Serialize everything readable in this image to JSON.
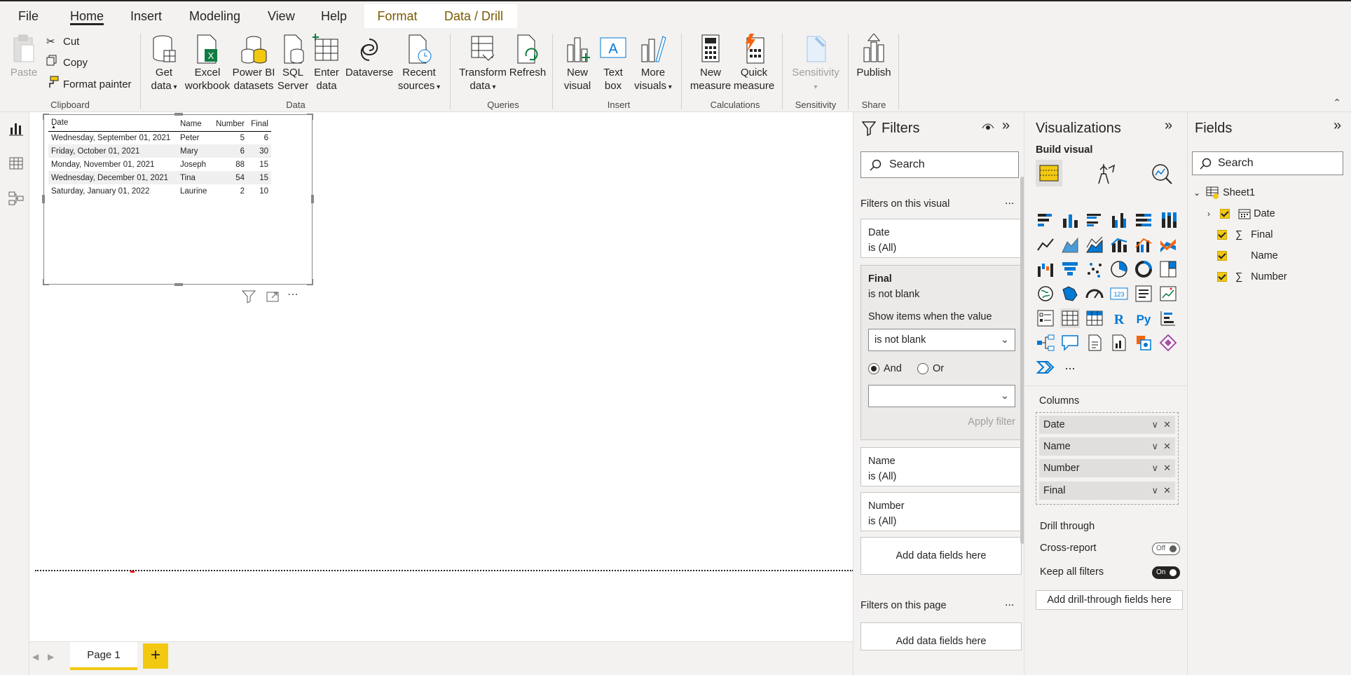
{
  "menu": {
    "tabs": [
      "File",
      "Home",
      "Insert",
      "Modeling",
      "View",
      "Help",
      "Format",
      "Data / Drill"
    ]
  },
  "ribbon": {
    "clipboard": {
      "paste": "Paste",
      "cut": "Cut",
      "copy": "Copy",
      "format_painter": "Format painter",
      "label": "Clipboard"
    },
    "data": {
      "get_data": [
        "Get",
        "data"
      ],
      "excel": [
        "Excel",
        "workbook"
      ],
      "powerbi": [
        "Power BI",
        "datasets"
      ],
      "sql": [
        "SQL",
        "Server"
      ],
      "enter": [
        "Enter",
        "data"
      ],
      "dataverse": "Dataverse",
      "recent": [
        "Recent",
        "sources"
      ],
      "label": "Data"
    },
    "queries": {
      "transform": [
        "Transform",
        "data"
      ],
      "refresh": "Refresh",
      "label": "Queries"
    },
    "insert": {
      "new_visual": [
        "New",
        "visual"
      ],
      "text_box": [
        "Text",
        "box"
      ],
      "more_visuals": [
        "More",
        "visuals"
      ],
      "label": "Insert"
    },
    "calculations": {
      "new_measure": [
        "New",
        "measure"
      ],
      "quick_measure": [
        "Quick",
        "measure"
      ],
      "label": "Calculations"
    },
    "sensitivity": {
      "btn": "Sensitivity",
      "label": "Sensitivity"
    },
    "share": {
      "publish": "Publish",
      "label": "Share"
    }
  },
  "table": {
    "headers": [
      "Date",
      "Name",
      "Number",
      "Final"
    ],
    "rows": [
      [
        "Wednesday, September 01, 2021",
        "Peter",
        "5",
        "6"
      ],
      [
        "Friday, October 01, 2021",
        "Mary",
        "6",
        "30"
      ],
      [
        "Monday, November 01, 2021",
        "Joseph",
        "88",
        "15"
      ],
      [
        "Wednesday, December 01, 2021",
        "Tina",
        "54",
        "15"
      ],
      [
        "Saturday, January 01, 2022",
        "Laurine",
        "2",
        "10"
      ]
    ]
  },
  "pages": {
    "tab": "Page 1",
    "add": "+"
  },
  "filters": {
    "title": "Filters",
    "search_placeholder": "Search",
    "on_visual": "Filters on this visual",
    "more": "...",
    "date_card": {
      "name": "Date",
      "state": "is (All)"
    },
    "final_card": {
      "name": "Final",
      "state": "is not blank",
      "show_items": "Show items when the value",
      "condition": "is not blank",
      "and": "And",
      "or": "Or",
      "apply": "Apply filter"
    },
    "name_card": {
      "name": "Name",
      "state": "is (All)"
    },
    "number_card": {
      "name": "Number",
      "state": "is (All)"
    },
    "add_fields": "Add data fields here",
    "on_page": "Filters on this page",
    "add_fields_page": "Add data fields here"
  },
  "visualizations": {
    "title": "Visualizations",
    "build": "Build visual",
    "more": "...",
    "columns_label": "Columns",
    "columns": [
      "Date",
      "Name",
      "Number",
      "Final"
    ],
    "drill_through": "Drill through",
    "cross_report": "Cross-report",
    "cross_report_state": "Off",
    "keep_filters": "Keep all filters",
    "keep_filters_state": "On",
    "add_drill": "Add drill-through fields here"
  },
  "fields": {
    "title": "Fields",
    "search_placeholder": "Search",
    "table": "Sheet1",
    "items": [
      {
        "name": "Date",
        "icon": "calendar-icon",
        "checked": true
      },
      {
        "name": "Final",
        "icon": "sigma-icon",
        "checked": true
      },
      {
        "name": "Name",
        "icon": "",
        "checked": true
      },
      {
        "name": "Number",
        "icon": "sigma-icon",
        "checked": true
      }
    ]
  },
  "colors": {
    "accent": "#f2c811",
    "text": "#252423",
    "pane": "#f3f2f1"
  }
}
